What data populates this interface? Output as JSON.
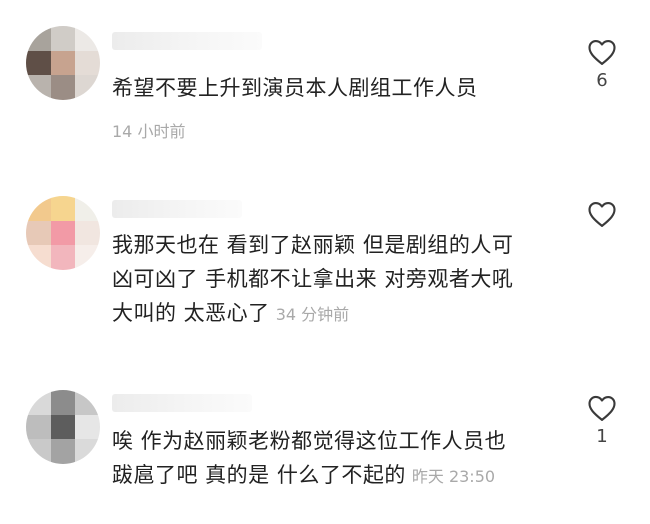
{
  "comments": [
    {
      "avatar_colors": [
        "#a8a39c",
        "#d0ccc7",
        "#ece9e6",
        "#5f4f47",
        "#c7a38f",
        "#e4dcd6",
        "#b9b3ad",
        "#9b8d85",
        "#ddd7d2"
      ],
      "lines": [
        "希望不要上升到演员本人剧组工作人员"
      ],
      "time": "14 小时前",
      "likes": "6"
    },
    {
      "avatar_colors": [
        "#f2c98d",
        "#f6d58f",
        "#f0efe9",
        "#e7c9b7",
        "#f29aa6",
        "#f1e6e0",
        "#f6ddd0",
        "#f2b6bd",
        "#f6eeea"
      ],
      "lines": [
        "我那天也在 看到了赵丽颖 但是剧组的人可",
        "凶可凶了 手机都不让拿出来 对旁观者大吼",
        "大叫的 太恶心了"
      ],
      "time": "34 分钟前",
      "likes": ""
    },
    {
      "avatar_colors": [
        "#d9d9d9",
        "#8c8c8c",
        "#c7c7c7",
        "#bdbdbd",
        "#5d5d5d",
        "#e6e6e6",
        "#c9c9c9",
        "#a3a3a3",
        "#dadada"
      ],
      "lines": [
        "唉 作为赵丽颖老粉都觉得这位工作人员也",
        "跋扈了吧 真的是 什么了不起的"
      ],
      "time": "昨天 23:50",
      "likes": "1"
    }
  ]
}
